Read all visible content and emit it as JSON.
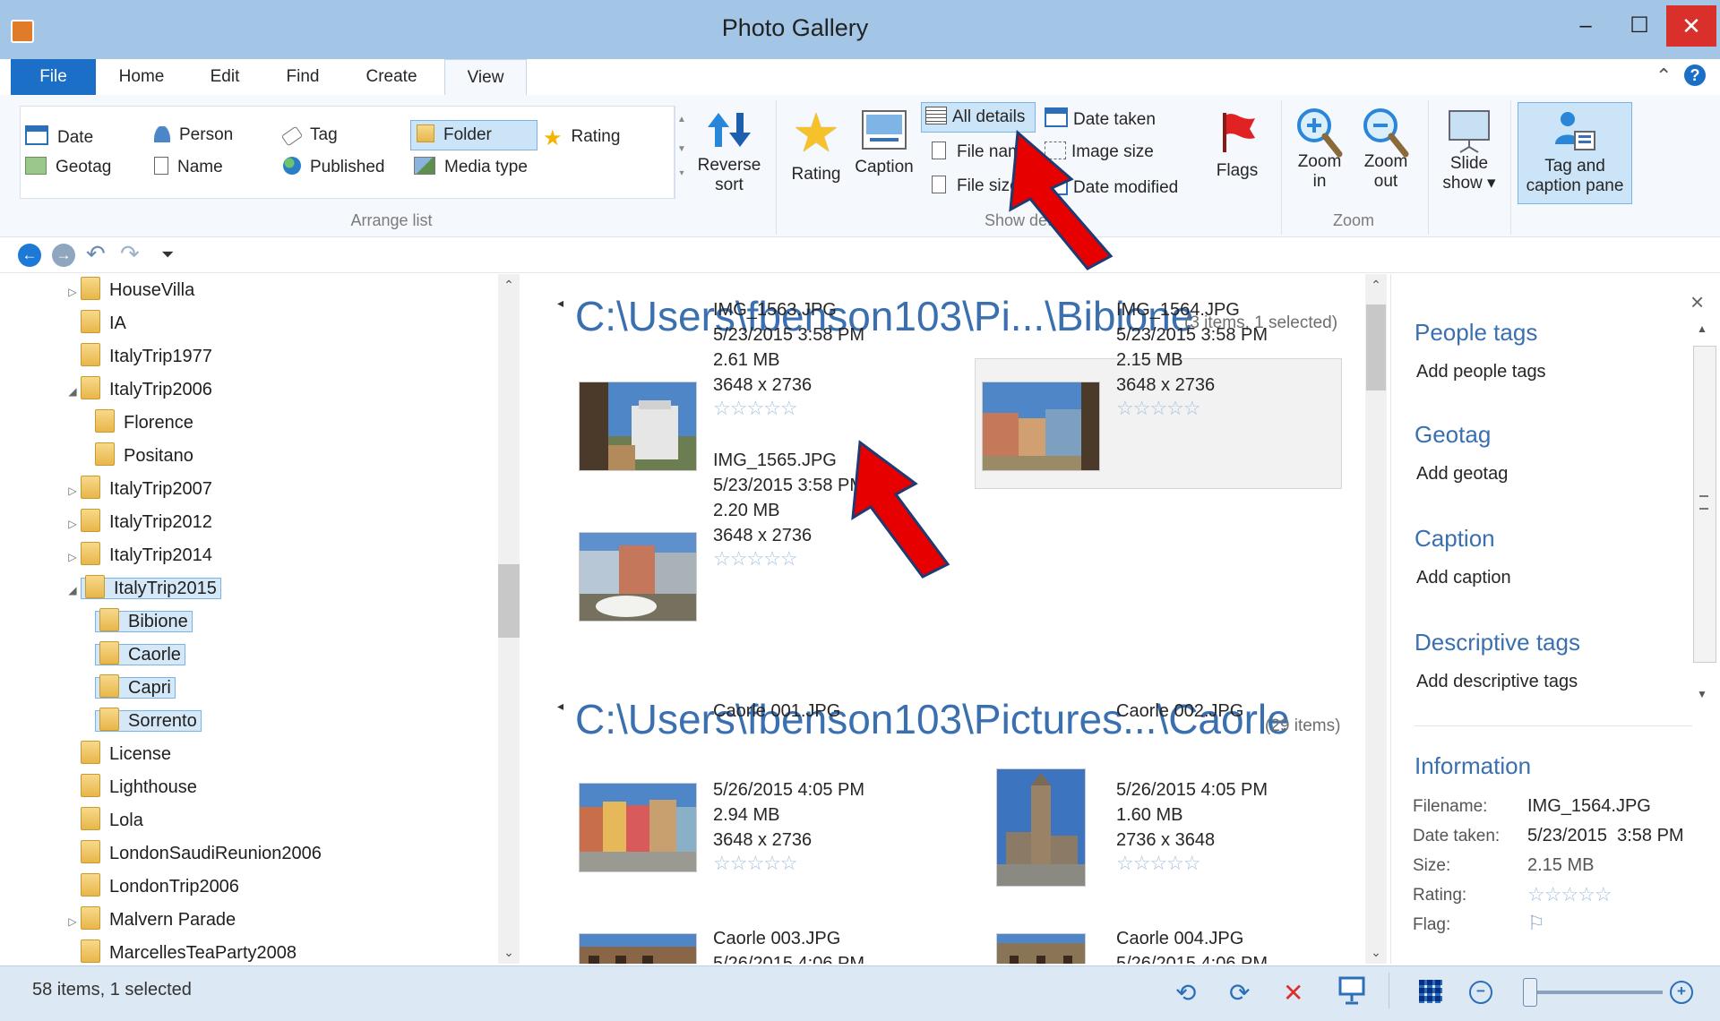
{
  "window": {
    "title": "Photo Gallery",
    "controls": {
      "minimize": "–",
      "maximize": "☐",
      "close": "✕"
    }
  },
  "tabs": [
    {
      "label": "File"
    },
    {
      "label": "Home"
    },
    {
      "label": "Edit"
    },
    {
      "label": "Find"
    },
    {
      "label": "Create"
    },
    {
      "label": "View"
    }
  ],
  "ribbon": {
    "arrange_list": {
      "label": "Arrange list",
      "items": {
        "date": "Date",
        "geotag": "Geotag",
        "person": "Person",
        "name": "Name",
        "tag": "Tag",
        "published": "Published",
        "folder": "Folder",
        "media_type": "Media type",
        "rating": "Rating"
      },
      "reverse_sort": "Reverse\nsort"
    },
    "show_details": {
      "label": "Show details",
      "rating": "Rating",
      "caption": "Caption",
      "all_details": "All details",
      "file_name": "File name",
      "file_size": "File size",
      "date_taken": "Date taken",
      "image_size": "Image size",
      "date_modified": "Date modified",
      "flags": "Flags"
    },
    "zoom": {
      "label": "Zoom",
      "zoom_in": "Zoom\nin",
      "zoom_out": "Zoom\nout"
    },
    "slide_show": "Slide\nshow ▾",
    "tag_caption_pane": "Tag and\ncaption pane"
  },
  "tree": {
    "items": [
      {
        "label": "HouseVilla",
        "caret": "▷",
        "indent": 0
      },
      {
        "label": "IA",
        "caret": "",
        "indent": 0
      },
      {
        "label": "ItalyTrip1977",
        "caret": "",
        "indent": 0
      },
      {
        "label": "ItalyTrip2006",
        "caret": "◢",
        "indent": 0
      },
      {
        "label": "Florence",
        "caret": "",
        "indent": 1
      },
      {
        "label": "Positano",
        "caret": "",
        "indent": 1
      },
      {
        "label": "ItalyTrip2007",
        "caret": "▷",
        "indent": 0
      },
      {
        "label": "ItalyTrip2012",
        "caret": "▷",
        "indent": 0
      },
      {
        "label": "ItalyTrip2014",
        "caret": "▷",
        "indent": 0
      },
      {
        "label": "ItalyTrip2015",
        "caret": "◢",
        "indent": 0,
        "selected": true
      },
      {
        "label": "Bibione",
        "caret": "",
        "indent": 1,
        "selected": true
      },
      {
        "label": "Caorle",
        "caret": "",
        "indent": 1,
        "selected": true
      },
      {
        "label": "Capri",
        "caret": "",
        "indent": 1,
        "selected": true
      },
      {
        "label": "Sorrento",
        "caret": "",
        "indent": 1,
        "selected": true
      },
      {
        "label": "License",
        "caret": "",
        "indent": 0
      },
      {
        "label": "Lighthouse",
        "caret": "",
        "indent": 0
      },
      {
        "label": "Lola",
        "caret": "",
        "indent": 0
      },
      {
        "label": "LondonSaudiReunion2006",
        "caret": "",
        "indent": 0
      },
      {
        "label": "LondonTrip2006",
        "caret": "",
        "indent": 0
      },
      {
        "label": "Malvern Parade",
        "caret": "▷",
        "indent": 0
      },
      {
        "label": "MarcellesTeaParty2008",
        "caret": "",
        "indent": 0
      }
    ]
  },
  "gallery": {
    "groups": [
      {
        "title": "C:\\Users\\fbenson103\\Pi...\\Bibione",
        "count": "(3 items, 1 selected)",
        "photos": [
          {
            "name": "IMG_1563.JPG",
            "date": "5/23/2015 3:58 PM",
            "size": "2.61 MB",
            "dims": "3648 x 2736"
          },
          {
            "name": "IMG_1564.JPG",
            "date": "5/23/2015 3:58 PM",
            "size": "2.15 MB",
            "dims": "3648 x 2736"
          },
          {
            "name": "IMG_1565.JPG",
            "date": "5/23/2015 3:58 PM",
            "size": "2.20 MB",
            "dims": "3648 x 2736"
          }
        ]
      },
      {
        "title": "C:\\Users\\fbenson103\\Pictures...\\Caorle",
        "count": "(29 items)",
        "photos": [
          {
            "name": "Caorle 001.JPG",
            "date": "5/26/2015 4:05 PM",
            "size": "2.94 MB",
            "dims": "3648 x 2736"
          },
          {
            "name": "Caorle 002.JPG",
            "date": "5/26/2015 4:05 PM",
            "size": "1.60 MB",
            "dims": "2736 x 3648"
          },
          {
            "name": "Caorle 003.JPG",
            "date": "5/26/2015 4:06 PM"
          },
          {
            "name": "Caorle 004.JPG",
            "date": "5/26/2015 4:06 PM"
          }
        ]
      }
    ],
    "stars": "☆☆☆☆☆"
  },
  "pane": {
    "close": "×",
    "people_tags": "People tags",
    "add_people_tags": "Add people tags",
    "geotag": "Geotag",
    "add_geotag": "Add geotag",
    "caption": "Caption",
    "add_caption": "Add caption",
    "descriptive_tags": "Descriptive tags",
    "add_descriptive_tags": "Add descriptive tags",
    "information": "Information",
    "info": {
      "filename_k": "Filename:",
      "filename_v": "IMG_1564.JPG",
      "date_k": "Date taken:",
      "date_v": "5/23/2015  3:58 PM",
      "size_k": "Size:",
      "size_v": "2.15 MB",
      "rating_k": "Rating:",
      "rating_v": "☆☆☆☆☆",
      "flag_k": "Flag:",
      "flag_v": "⚐"
    }
  },
  "status": {
    "text": "58 items, 1 selected"
  },
  "colors": {
    "accent": "#1b6fc6",
    "title_bar": "#a4c6e6",
    "link_blue": "#3a6fb0",
    "close_red": "#d9302c",
    "annotation_red": "#e60000"
  }
}
